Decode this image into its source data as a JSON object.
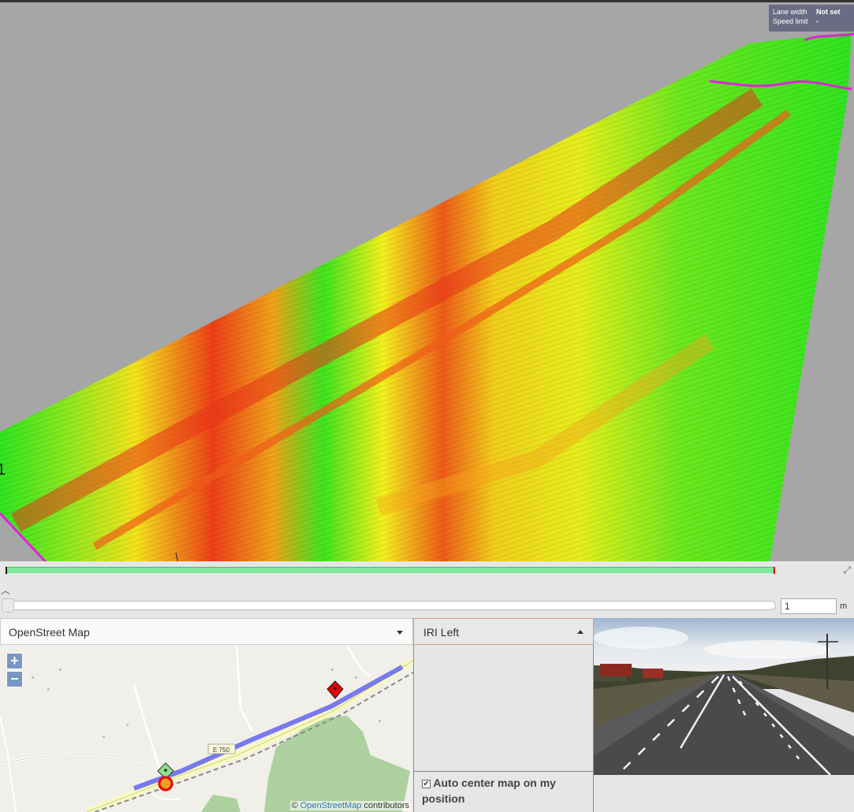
{
  "info": {
    "lane_width_label": "Lane width",
    "lane_width_value": "Not set",
    "speed_limit_label": "Speed limit",
    "speed_limit_value": "-"
  },
  "viewport": {
    "marker_label": "1",
    "colors": {
      "low": "#2ee51f",
      "mid": "#f4f21c",
      "high": "#f0431a",
      "edge_marker": "#e51fe0",
      "background": "#a6a6a6"
    }
  },
  "timeline": {
    "distance_value": "1",
    "distance_unit": "m"
  },
  "map": {
    "layer_selected": "OpenStreet Map",
    "zoom_in": "+",
    "zoom_out": "−",
    "road_label": "E 750",
    "attribution_prefix": "©",
    "attribution_link": "OpenStreetMap",
    "attribution_suffix": "contributors"
  },
  "metric": {
    "selected": "IRI Left",
    "auto_center_label": "Auto center map on my position",
    "auto_center_checked": true
  }
}
